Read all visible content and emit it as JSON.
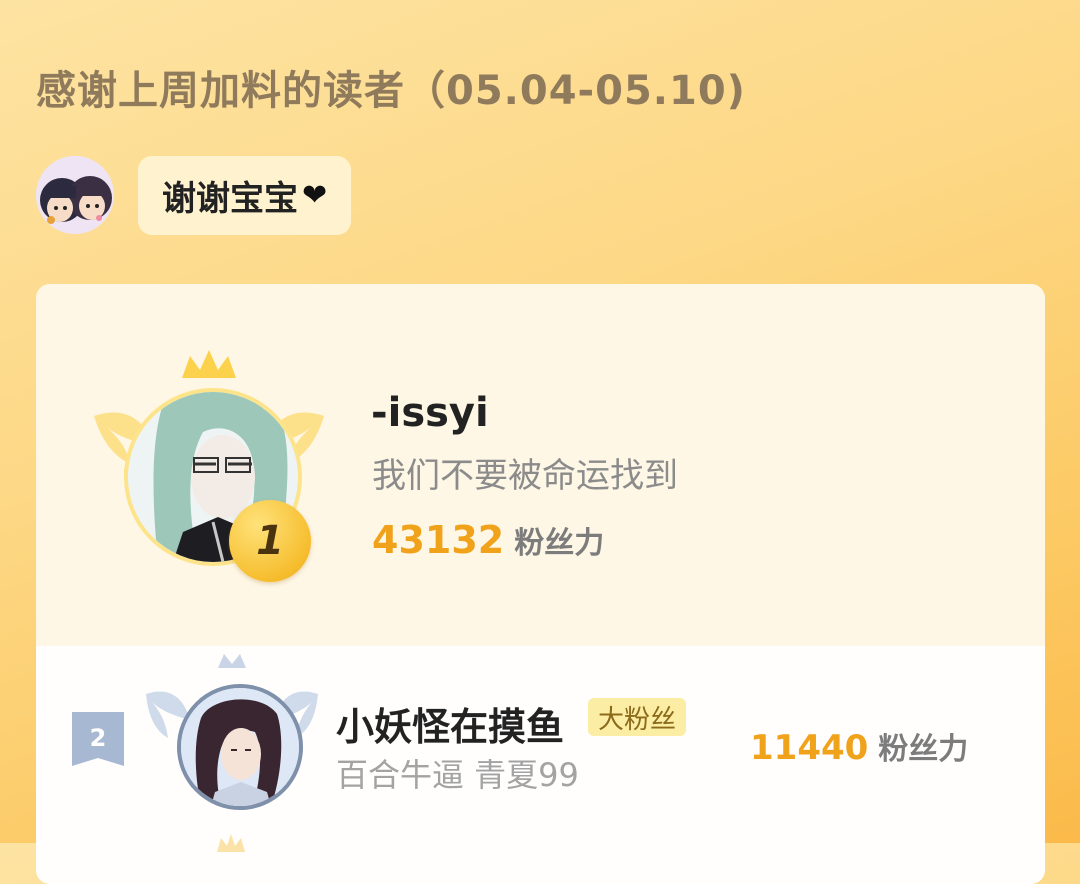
{
  "header": {
    "title": "感谢上周加料的读者（05.04-05.10)"
  },
  "author_note": {
    "text": "谢谢宝宝",
    "icon": "heart-icon"
  },
  "leaderboard": [
    {
      "rank": "1",
      "name": "-issyi",
      "subtitle": "我们不要被命运找到",
      "score": "43132",
      "unit": "粉丝力"
    },
    {
      "rank": "2",
      "name": "小妖怪在摸鱼",
      "badge": "大粉丝",
      "subtitle": "百合牛逼 青夏99",
      "score": "11440",
      "unit": "粉丝力"
    }
  ],
  "colors": {
    "accent": "#f0a21a",
    "gold": "#fbd04a",
    "silver": "#a7b8d2",
    "card": "#fef7e6"
  }
}
